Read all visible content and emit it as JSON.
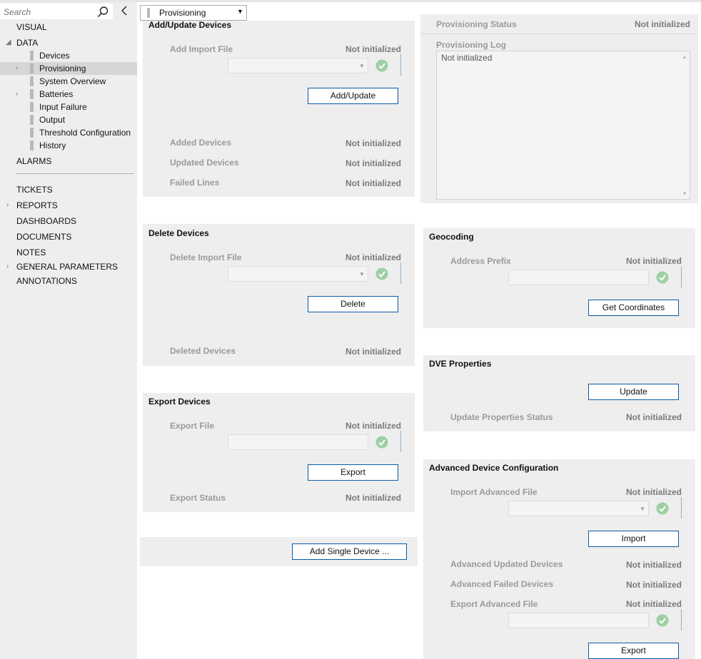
{
  "search": {
    "placeholder": "Search"
  },
  "sidebar": {
    "visual": "VISUAL",
    "data": "DATA",
    "data_children": {
      "devices": "Devices",
      "provisioning": "Provisioning",
      "system_overview": "System Overview",
      "batteries": "Batteries",
      "input_failure": "Input Failure",
      "output": "Output",
      "threshold_configuration": "Threshold Configuration",
      "history": "History"
    },
    "alarms": "ALARMS",
    "tickets": "TICKETS",
    "reports": "REPORTS",
    "dashboards": "DASHBOARDS",
    "documents": "DOCUMENTS",
    "notes": "NOTES",
    "general_parameters": "GENERAL PARAMETERS",
    "annotations": "ANNOTATIONS"
  },
  "view_select": {
    "value": "Provisioning"
  },
  "not_init": "Not initialized",
  "add_update": {
    "title": "Add/Update Devices",
    "import_label": "Add Import File",
    "button": "Add/Update",
    "added_label": "Added Devices",
    "updated_label": "Updated Devices",
    "failed_label": "Failed Lines"
  },
  "delete": {
    "title": "Delete Devices",
    "import_label": "Delete Import File",
    "button": "Delete",
    "deleted_label": "Deleted Devices"
  },
  "export": {
    "title": "Export Devices",
    "file_label": "Export File",
    "button": "Export",
    "status_label": "Export Status"
  },
  "single": {
    "button": "Add Single Device ..."
  },
  "status": {
    "status_label": "Provisioning Status",
    "log_label": "Provisioning Log",
    "log_text": "Not initialized"
  },
  "geocoding": {
    "title": "Geocoding",
    "prefix_label": "Address Prefix",
    "button": "Get Coordinates"
  },
  "dve": {
    "title": "DVE Properties",
    "button": "Update",
    "status_label": "Update Properties Status"
  },
  "advanced": {
    "title": "Advanced Device Configuration",
    "import_label": "Import Advanced File",
    "import_button": "Import",
    "updated_label": "Advanced Updated Devices",
    "failed_label": "Advanced Failed Devices",
    "export_label": "Export Advanced File",
    "export_button": "Export"
  },
  "colors": {
    "panel": "#eeeeee",
    "accent": "#0a5aa8",
    "check": "#9ecfa2"
  }
}
